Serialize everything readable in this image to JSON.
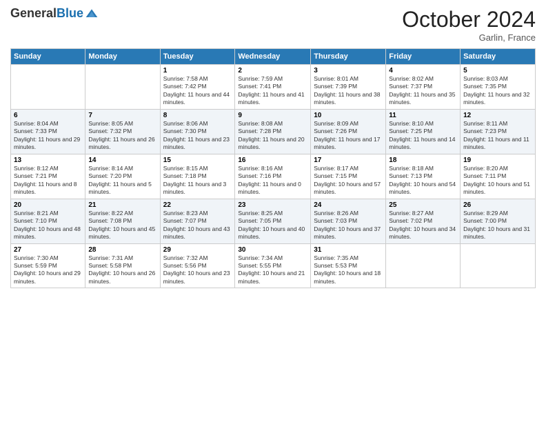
{
  "header": {
    "logo_line1": "General",
    "logo_line2": "Blue",
    "month_title": "October 2024",
    "location": "Garlin, France"
  },
  "days_of_week": [
    "Sunday",
    "Monday",
    "Tuesday",
    "Wednesday",
    "Thursday",
    "Friday",
    "Saturday"
  ],
  "weeks": [
    [
      {
        "day": "",
        "info": ""
      },
      {
        "day": "",
        "info": ""
      },
      {
        "day": "1",
        "info": "Sunrise: 7:58 AM\nSunset: 7:42 PM\nDaylight: 11 hours and 44 minutes."
      },
      {
        "day": "2",
        "info": "Sunrise: 7:59 AM\nSunset: 7:41 PM\nDaylight: 11 hours and 41 minutes."
      },
      {
        "day": "3",
        "info": "Sunrise: 8:01 AM\nSunset: 7:39 PM\nDaylight: 11 hours and 38 minutes."
      },
      {
        "day": "4",
        "info": "Sunrise: 8:02 AM\nSunset: 7:37 PM\nDaylight: 11 hours and 35 minutes."
      },
      {
        "day": "5",
        "info": "Sunrise: 8:03 AM\nSunset: 7:35 PM\nDaylight: 11 hours and 32 minutes."
      }
    ],
    [
      {
        "day": "6",
        "info": "Sunrise: 8:04 AM\nSunset: 7:33 PM\nDaylight: 11 hours and 29 minutes."
      },
      {
        "day": "7",
        "info": "Sunrise: 8:05 AM\nSunset: 7:32 PM\nDaylight: 11 hours and 26 minutes."
      },
      {
        "day": "8",
        "info": "Sunrise: 8:06 AM\nSunset: 7:30 PM\nDaylight: 11 hours and 23 minutes."
      },
      {
        "day": "9",
        "info": "Sunrise: 8:08 AM\nSunset: 7:28 PM\nDaylight: 11 hours and 20 minutes."
      },
      {
        "day": "10",
        "info": "Sunrise: 8:09 AM\nSunset: 7:26 PM\nDaylight: 11 hours and 17 minutes."
      },
      {
        "day": "11",
        "info": "Sunrise: 8:10 AM\nSunset: 7:25 PM\nDaylight: 11 hours and 14 minutes."
      },
      {
        "day": "12",
        "info": "Sunrise: 8:11 AM\nSunset: 7:23 PM\nDaylight: 11 hours and 11 minutes."
      }
    ],
    [
      {
        "day": "13",
        "info": "Sunrise: 8:12 AM\nSunset: 7:21 PM\nDaylight: 11 hours and 8 minutes."
      },
      {
        "day": "14",
        "info": "Sunrise: 8:14 AM\nSunset: 7:20 PM\nDaylight: 11 hours and 5 minutes."
      },
      {
        "day": "15",
        "info": "Sunrise: 8:15 AM\nSunset: 7:18 PM\nDaylight: 11 hours and 3 minutes."
      },
      {
        "day": "16",
        "info": "Sunrise: 8:16 AM\nSunset: 7:16 PM\nDaylight: 11 hours and 0 minutes."
      },
      {
        "day": "17",
        "info": "Sunrise: 8:17 AM\nSunset: 7:15 PM\nDaylight: 10 hours and 57 minutes."
      },
      {
        "day": "18",
        "info": "Sunrise: 8:18 AM\nSunset: 7:13 PM\nDaylight: 10 hours and 54 minutes."
      },
      {
        "day": "19",
        "info": "Sunrise: 8:20 AM\nSunset: 7:11 PM\nDaylight: 10 hours and 51 minutes."
      }
    ],
    [
      {
        "day": "20",
        "info": "Sunrise: 8:21 AM\nSunset: 7:10 PM\nDaylight: 10 hours and 48 minutes."
      },
      {
        "day": "21",
        "info": "Sunrise: 8:22 AM\nSunset: 7:08 PM\nDaylight: 10 hours and 45 minutes."
      },
      {
        "day": "22",
        "info": "Sunrise: 8:23 AM\nSunset: 7:07 PM\nDaylight: 10 hours and 43 minutes."
      },
      {
        "day": "23",
        "info": "Sunrise: 8:25 AM\nSunset: 7:05 PM\nDaylight: 10 hours and 40 minutes."
      },
      {
        "day": "24",
        "info": "Sunrise: 8:26 AM\nSunset: 7:03 PM\nDaylight: 10 hours and 37 minutes."
      },
      {
        "day": "25",
        "info": "Sunrise: 8:27 AM\nSunset: 7:02 PM\nDaylight: 10 hours and 34 minutes."
      },
      {
        "day": "26",
        "info": "Sunrise: 8:29 AM\nSunset: 7:00 PM\nDaylight: 10 hours and 31 minutes."
      }
    ],
    [
      {
        "day": "27",
        "info": "Sunrise: 7:30 AM\nSunset: 5:59 PM\nDaylight: 10 hours and 29 minutes."
      },
      {
        "day": "28",
        "info": "Sunrise: 7:31 AM\nSunset: 5:58 PM\nDaylight: 10 hours and 26 minutes."
      },
      {
        "day": "29",
        "info": "Sunrise: 7:32 AM\nSunset: 5:56 PM\nDaylight: 10 hours and 23 minutes."
      },
      {
        "day": "30",
        "info": "Sunrise: 7:34 AM\nSunset: 5:55 PM\nDaylight: 10 hours and 21 minutes."
      },
      {
        "day": "31",
        "info": "Sunrise: 7:35 AM\nSunset: 5:53 PM\nDaylight: 10 hours and 18 minutes."
      },
      {
        "day": "",
        "info": ""
      },
      {
        "day": "",
        "info": ""
      }
    ]
  ]
}
